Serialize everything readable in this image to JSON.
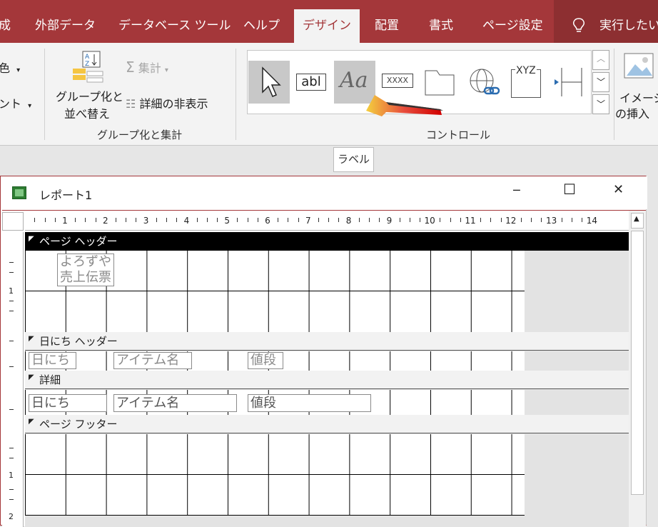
{
  "ribbon_tabs": [
    "成",
    "外部データ",
    "データベース ツール",
    "ヘルプ",
    "デザイン",
    "配置",
    "書式",
    "ページ設定",
    "実行したい作業"
  ],
  "active_tab": "デザイン",
  "ribbon": {
    "left_partial_1": "色",
    "left_partial_2": "ント",
    "group_by_label_line1": "グループ化と",
    "group_by_label_line2": "並べ替え",
    "totals_label": "集計",
    "hide_details_label": "詳細の非表示",
    "group_section_label": "グループ化と集計",
    "controls_section_label": "コントロール",
    "label_control_text": "Aa",
    "textbox_control_text": "abl",
    "button_control_text": "XXXX",
    "chart_control_text": "XYZ",
    "insert_image_line1": "イメージ",
    "insert_image_line2": "の挿入"
  },
  "tooltip": "ラベル",
  "window": {
    "title": "レポート1",
    "minimize": "─",
    "maximize": "☐",
    "close": "✕"
  },
  "ruler_h_marks": [
    "1",
    "2",
    "3",
    "4",
    "5",
    "6",
    "7",
    "8",
    "9",
    "10",
    "11",
    "12",
    "13",
    "14"
  ],
  "ruler_v_marks": [
    "1",
    "2"
  ],
  "sections": {
    "page_header": "ページ ヘッダー",
    "date_header": "日にち ヘッダー",
    "detail": "詳細",
    "page_footer": "ページ フッター"
  },
  "page_header_label_line1": "よろずや",
  "page_header_label_line2": "売上伝票",
  "date_header_labels": [
    "日にち",
    "アイテム名",
    "値段"
  ],
  "detail_fields": [
    "日にち",
    "アイテム名",
    "値段"
  ],
  "colors": {
    "accent": "#a4373a",
    "ribbon_bg": "#f3f3f3"
  }
}
